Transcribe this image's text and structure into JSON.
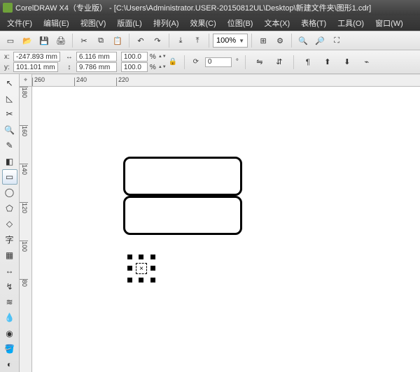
{
  "window": {
    "app_name": "CorelDRAW X4（专业版）",
    "doc_path": "[C:\\Users\\Administrator.USER-20150812UL\\Desktop\\新建文件夹\\图形1.cdr]"
  },
  "menu": {
    "file": "文件(F)",
    "edit": "编辑(E)",
    "view": "视图(V)",
    "layout": "版面(L)",
    "arrange": "排列(A)",
    "effects": "效果(C)",
    "bitmap": "位图(B)",
    "text": "文本(X)",
    "table": "表格(T)",
    "tools": "工具(O)",
    "window": "窗口(W)"
  },
  "toolbar": {
    "zoom_value": "100%"
  },
  "properties": {
    "x_label": "x:",
    "y_label": "y:",
    "x_value": "-247.893 mm",
    "y_value": "101.101 mm",
    "w_value": "6.116 mm",
    "h_value": "9.786 mm",
    "scale_x": "100.0",
    "scale_y": "100.0",
    "pct_x": "%",
    "pct_y": "%",
    "rotation": "0",
    "units_deg": "°"
  },
  "ruler": {
    "h_ticks": [
      "260",
      "240",
      "220"
    ],
    "v_ticks": [
      "180",
      "160",
      "140",
      "120",
      "100",
      "80"
    ]
  },
  "tools": {
    "pick": "pick-tool",
    "shape": "shape-tool",
    "crop": "crop-tool",
    "zoom": "zoom-tool",
    "freehand": "freehand-tool",
    "smart": "smart-fill-tool",
    "rectangle": "rectangle-tool",
    "ellipse": "ellipse-tool",
    "polygon": "polygon-tool",
    "basic": "basic-shapes-tool",
    "text": "text-tool",
    "table": "table-tool",
    "dim": "dimension-tool",
    "conn": "connector-tool",
    "blend": "interactive-blend-tool",
    "eyedrop": "eyedropper-tool",
    "outline": "outline-tool",
    "fill": "fill-tool",
    "ifill": "interactive-fill-tool"
  }
}
